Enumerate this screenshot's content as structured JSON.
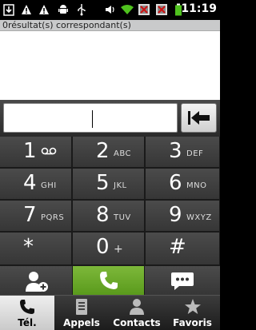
{
  "status_bar": {
    "time": "11:19",
    "icons": [
      "download-icon",
      "warning-icon",
      "warning-icon",
      "android-icon",
      "usb-icon",
      "volume-icon",
      "wifi-icon",
      "no-sim-icon",
      "no-sim-icon",
      "battery-icon"
    ]
  },
  "results": {
    "header": "0résultat(s) correspondant(s)"
  },
  "input": {
    "value": ""
  },
  "keypad": {
    "keys": [
      {
        "digit": "1",
        "letters": "",
        "icon": "voicemail-icon"
      },
      {
        "digit": "2",
        "letters": "ABC"
      },
      {
        "digit": "3",
        "letters": "DEF"
      },
      {
        "digit": "4",
        "letters": "GHI"
      },
      {
        "digit": "5",
        "letters": "JKL"
      },
      {
        "digit": "6",
        "letters": "MNO"
      },
      {
        "digit": "7",
        "letters": "PQRS"
      },
      {
        "digit": "8",
        "letters": "TUV"
      },
      {
        "digit": "9",
        "letters": "WXYZ"
      },
      {
        "digit": "*",
        "letters": ""
      },
      {
        "digit": "0",
        "letters": "+"
      },
      {
        "digit": "#",
        "letters": ""
      }
    ]
  },
  "actions": {
    "add_contact": "add-contact-icon",
    "call": "phone-icon",
    "sms": "sms-icon"
  },
  "tabs": [
    {
      "label": "Tél.",
      "icon": "phone-icon",
      "active": true
    },
    {
      "label": "Appels",
      "icon": "call-log-icon",
      "active": false
    },
    {
      "label": "Contacts",
      "icon": "person-icon",
      "active": false
    },
    {
      "label": "Favoris",
      "icon": "star-icon",
      "active": false
    }
  ],
  "colors": {
    "call_green": "#6aa92a",
    "keypad_bg": "#3f3f3f",
    "active_tab": "#e0e0e0"
  }
}
